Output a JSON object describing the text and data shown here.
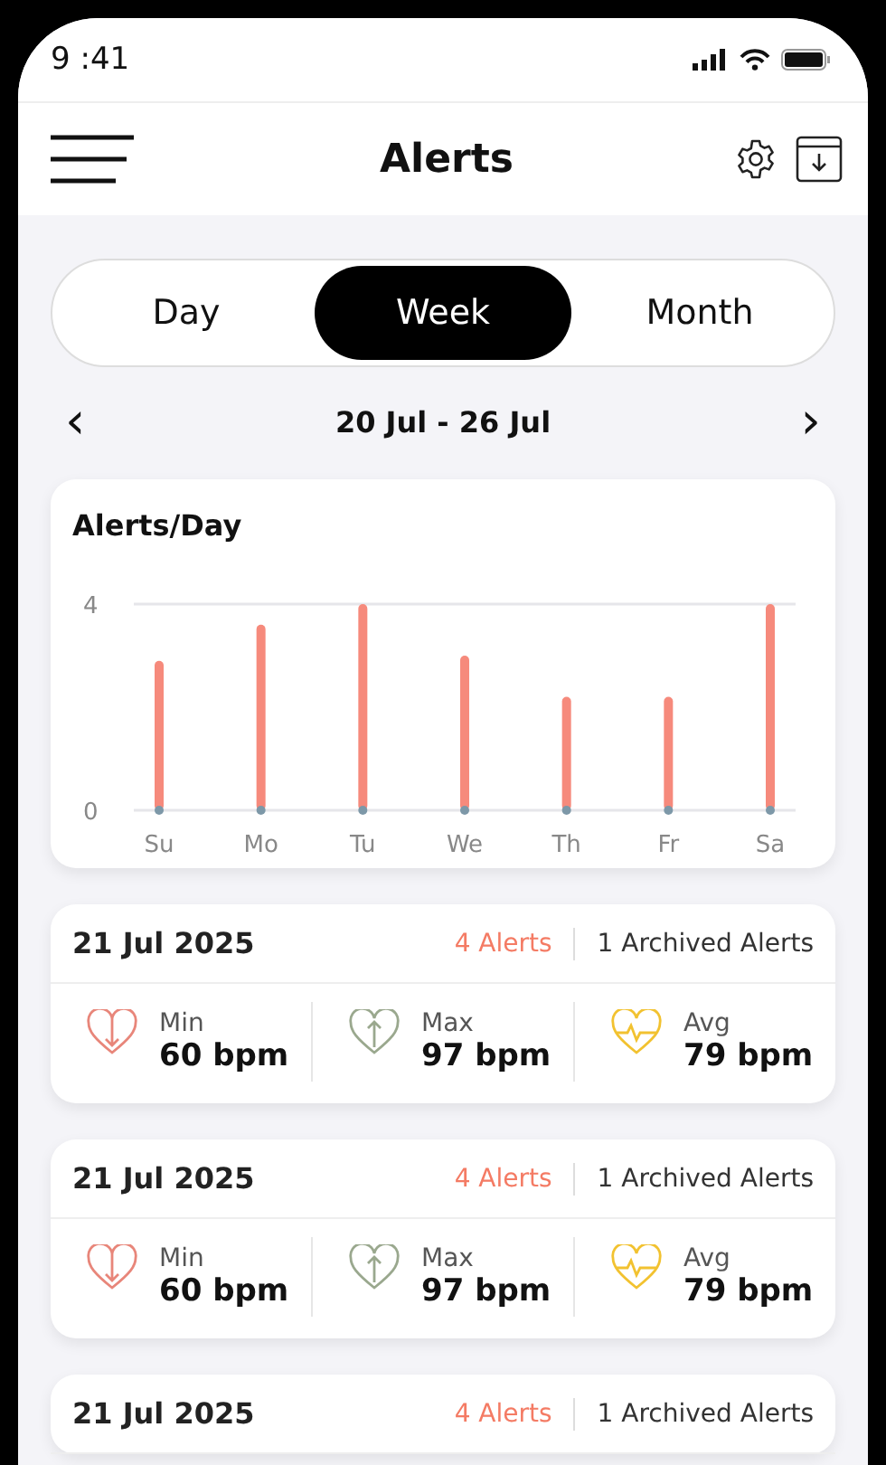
{
  "status_bar": {
    "time": "9 :41"
  },
  "header": {
    "title": "Alerts"
  },
  "periods": [
    {
      "label": "Day",
      "selected": false
    },
    {
      "label": "Week",
      "selected": true
    },
    {
      "label": "Month",
      "selected": false
    }
  ],
  "range": {
    "prev": "‹",
    "label": "20 Jul - 26 Jul",
    "next": "›"
  },
  "chart_card": {
    "title": "Alerts/Day",
    "chart_data": {
      "type": "bar",
      "categories": [
        "Su",
        "Mo",
        "Tu",
        "We",
        "Th",
        "Fr",
        "Sa"
      ],
      "values": [
        2.9,
        3.6,
        4.0,
        3.0,
        2.2,
        2.2,
        4.0
      ],
      "ylim": [
        0,
        4
      ],
      "yticks": [
        0,
        4
      ]
    }
  },
  "days": [
    {
      "date": "21 Jul 2025",
      "alerts": "4 Alerts",
      "archived": "1 Archived Alerts",
      "stats": [
        {
          "kind": "min",
          "label": "Min",
          "value": "60 bpm",
          "color": "#e8867a"
        },
        {
          "kind": "max",
          "label": "Max",
          "value": "97 bpm",
          "color": "#9aa88e"
        },
        {
          "kind": "avg",
          "label": "Avg",
          "value": "79 bpm",
          "color": "#f2c230"
        }
      ]
    },
    {
      "date": "21 Jul 2025",
      "alerts": "4 Alerts",
      "archived": "1 Archived Alerts",
      "stats": [
        {
          "kind": "min",
          "label": "Min",
          "value": "60 bpm",
          "color": "#e8867a"
        },
        {
          "kind": "max",
          "label": "Max",
          "value": "97 bpm",
          "color": "#9aa88e"
        },
        {
          "kind": "avg",
          "label": "Avg",
          "value": "79 bpm",
          "color": "#f2c230"
        }
      ]
    },
    {
      "date": "21 Jul 2025",
      "alerts": "4 Alerts",
      "archived": "1 Archived Alerts"
    }
  ]
}
